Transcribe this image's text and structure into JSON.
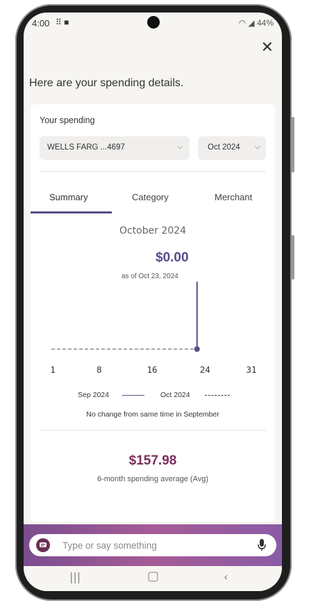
{
  "status_bar": {
    "time": "4:00",
    "battery": "44%"
  },
  "heading": "Here are your spending details.",
  "card": {
    "title": "Your spending",
    "account_select": "WELLS FARG ...4697",
    "month_select": "Oct 2024"
  },
  "tabs": [
    "Summary",
    "Category",
    "Merchant"
  ],
  "summary": {
    "month_title": "October 2024",
    "amount": "$0.00",
    "as_of": "as of Oct 23, 2024",
    "note": "No change from same time in September",
    "avg_amount": "$157.98",
    "avg_label": "6-month spending average (Avg)"
  },
  "chart_data": {
    "type": "line",
    "x_ticks": [
      "1",
      "8",
      "16",
      "24",
      "31"
    ],
    "xlim": [
      1,
      31
    ],
    "series": [
      {
        "name": "Sep 2024",
        "style": "solid",
        "x": [],
        "y": []
      },
      {
        "name": "Oct 2024",
        "style": "dashed",
        "x": [
          1,
          23
        ],
        "y": [
          0,
          0
        ]
      }
    ],
    "marker": {
      "x": 23,
      "y": 0
    }
  },
  "input": {
    "placeholder": "Type or say something"
  },
  "colors": {
    "accent": "#5b4b8a",
    "avg": "#7a2f5c"
  }
}
